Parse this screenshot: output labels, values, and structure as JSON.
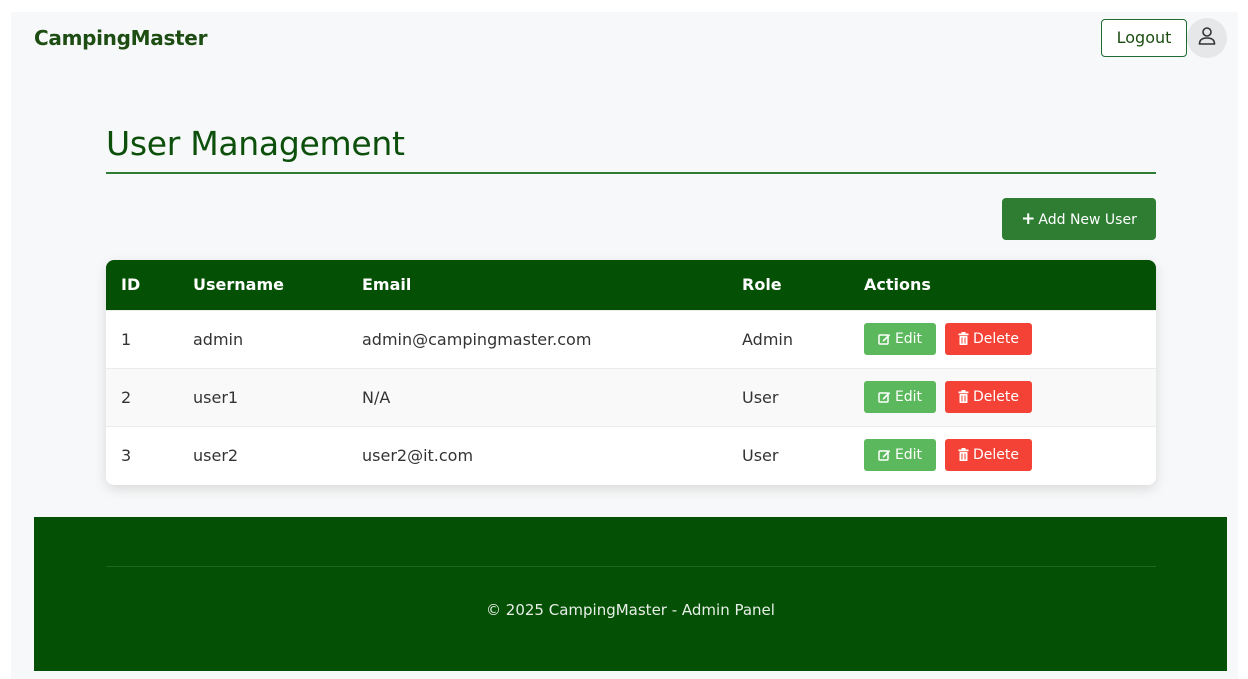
{
  "nav": {
    "brand": "CampingMaster",
    "logout_label": "Logout",
    "avatar_icon": "user-icon"
  },
  "main": {
    "title": "User Management",
    "add_button_icon": "plus-icon",
    "add_button_label": "Add New User"
  },
  "table": {
    "columns": [
      "ID",
      "Username",
      "Email",
      "Role",
      "Actions"
    ],
    "rows": [
      {
        "id": "1",
        "username": "admin",
        "email": "admin@campingmaster.com",
        "role": "Admin"
      },
      {
        "id": "2",
        "username": "user1",
        "email": "N/A",
        "role": "User"
      },
      {
        "id": "3",
        "username": "user2",
        "email": "user2@it.com",
        "role": "User"
      }
    ],
    "edit_label": "Edit",
    "delete_label": "Delete",
    "edit_icon": "edit-icon",
    "delete_icon": "trash-icon"
  },
  "footer": {
    "text": "© 2025 CampingMaster - Admin Panel"
  },
  "colors": {
    "brand_green": "#045004",
    "accent_green": "#2e7d32",
    "edit_green": "#5cb85c",
    "delete_red": "#f44336"
  }
}
